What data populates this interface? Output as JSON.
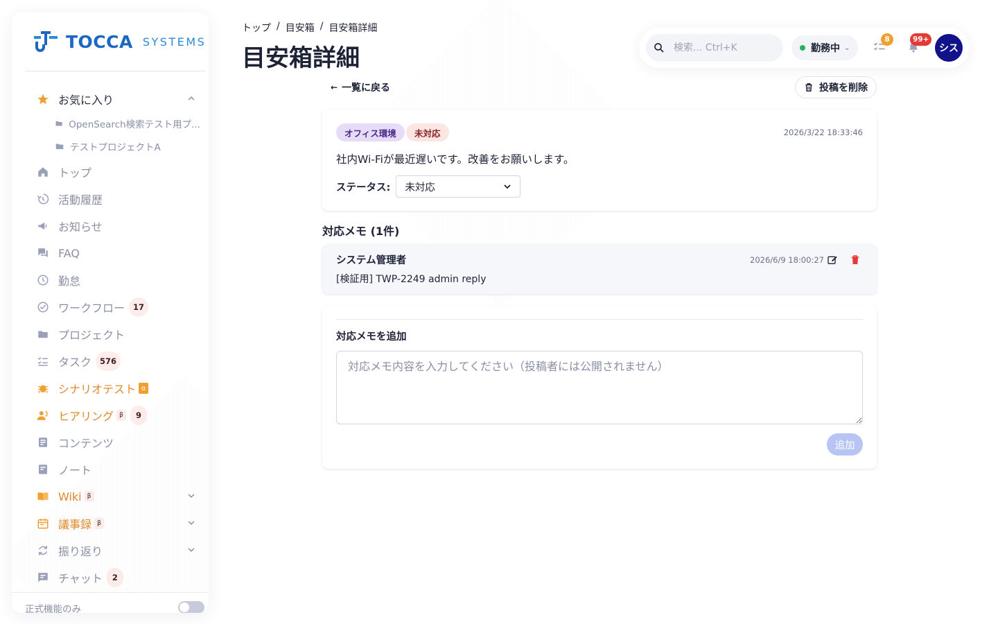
{
  "brand": {
    "name": "TOCCA",
    "sub": "SYSTEMS"
  },
  "sidebar": {
    "favorites": {
      "label": "お気に入り",
      "items": [
        {
          "label": "OpenSearch検索テスト用プ..."
        },
        {
          "label": "テストプロジェクトA"
        }
      ]
    },
    "items": [
      {
        "label": "トップ",
        "icon": "home-icon"
      },
      {
        "label": "活動履歴",
        "icon": "history-icon"
      },
      {
        "label": "お知らせ",
        "icon": "megaphone-icon"
      },
      {
        "label": "FAQ",
        "icon": "forum-icon"
      },
      {
        "label": "勤怠",
        "icon": "clock-icon"
      },
      {
        "label": "ワークフロー",
        "icon": "check-circle-icon",
        "badge": "17"
      },
      {
        "label": "プロジェクト",
        "icon": "folder-icon"
      },
      {
        "label": "タスク",
        "icon": "checklist-icon",
        "badge": "576"
      },
      {
        "label": "シナリオテスト",
        "icon": "bug-icon",
        "tag": "α"
      },
      {
        "label": "ヒアリング",
        "icon": "people-speaking-icon",
        "tag": "β",
        "badge": "9"
      },
      {
        "label": "コンテンツ",
        "icon": "article-icon"
      },
      {
        "label": "ノート",
        "icon": "note-icon"
      },
      {
        "label": "Wiki",
        "icon": "book-icon",
        "tag": "β"
      },
      {
        "label": "議事録",
        "icon": "calendar-icon",
        "tag": "β"
      },
      {
        "label": "振り返り",
        "icon": "refresh-icon"
      },
      {
        "label": "チャット",
        "icon": "chat-icon",
        "badge": "2"
      }
    ],
    "footer_label": "正式機能のみ"
  },
  "breadcrumb": [
    "トップ",
    "目安箱",
    "目安箱詳細"
  ],
  "page_title": "目安箱詳細",
  "topbar": {
    "search_placeholder": "検索... Ctrl+K",
    "status": "勤務中",
    "task_badge": "8",
    "notif_badge": "99+",
    "avatar": "シス"
  },
  "actions": {
    "back": "一覧に戻る",
    "delete": "投稿を削除"
  },
  "post": {
    "category": "オフィス環境",
    "status_tag": "未対応",
    "date": "2026/3/22 18:33:46",
    "body": "社内Wi-Fiが最近遅いです。改善をお願いします。",
    "status_label": "ステータス:",
    "status_value": "未対応"
  },
  "memos": {
    "title": "対応メモ (1件)",
    "items": [
      {
        "author": "システム管理者",
        "date": "2026/6/9 18:00:27",
        "text": "[検証用] TWP-2249 admin reply"
      }
    ]
  },
  "add_memo": {
    "title": "対応メモを追加",
    "placeholder": "対応メモ内容を入力してください（投稿者には公開されません）",
    "button": "追加"
  },
  "colors": {
    "accent_orange": "#e0892a",
    "avatar_bg": "#12128a",
    "status_green": "#22b35e",
    "danger": "#e53935"
  }
}
